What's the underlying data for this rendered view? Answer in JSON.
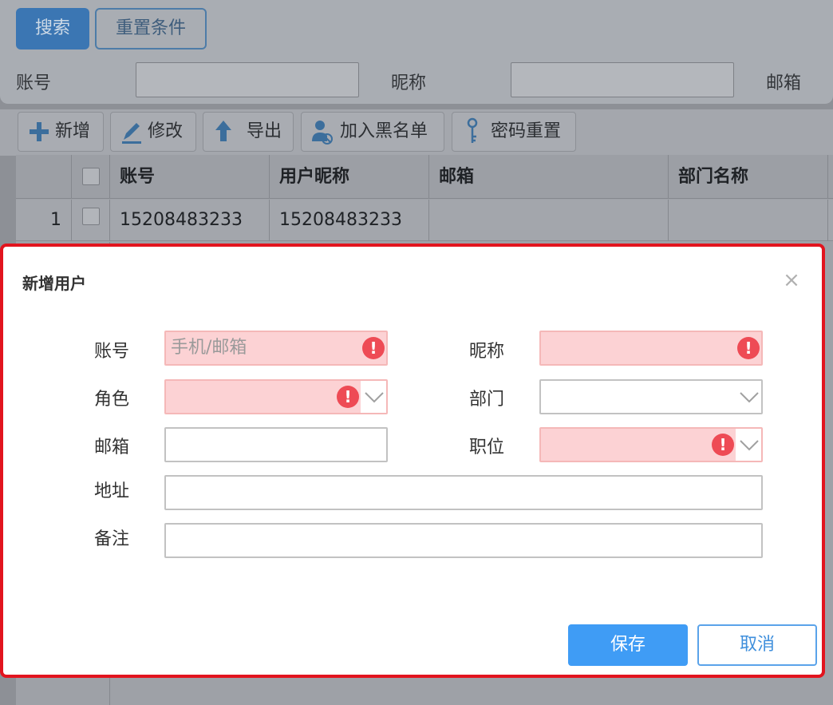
{
  "search": {
    "search_button": "搜索",
    "reset_button": "重置条件",
    "account_label": "账号",
    "nickname_label": "昵称",
    "email_label": "邮箱"
  },
  "toolbar": {
    "add": "新增",
    "edit": "修改",
    "export": "导出",
    "blacklist": "加入黑名单",
    "reset_password": "密码重置"
  },
  "grid": {
    "columns": [
      "账号",
      "用户昵称",
      "邮箱",
      "部门名称"
    ],
    "rows": [
      {
        "index": "1",
        "account": "15208483233",
        "nickname": "15208483233",
        "email": "",
        "department": ""
      }
    ]
  },
  "dialog": {
    "title": "新增用户",
    "close_symbol": "×",
    "account_label": "账号",
    "account_placeholder": "手机/邮箱",
    "nickname_label": "昵称",
    "role_label": "角色",
    "department_label": "部门",
    "email_label": "邮箱",
    "position_label": "职位",
    "address_label": "地址",
    "remark_label": "备注",
    "error_symbol": "!",
    "save_button": "保存",
    "cancel_button": "取消"
  },
  "colors": {
    "primary": "#3f9cf5",
    "error": "#ee4b55",
    "error_fill": "#fcd2d4",
    "highlight_border": "#e2141e"
  },
  "icons": [
    "plus-icon",
    "pencil-icon",
    "upload-arrow-icon",
    "user-block-icon",
    "key-icon",
    "close-icon",
    "exclamation-icon",
    "chevron-down-icon"
  ]
}
